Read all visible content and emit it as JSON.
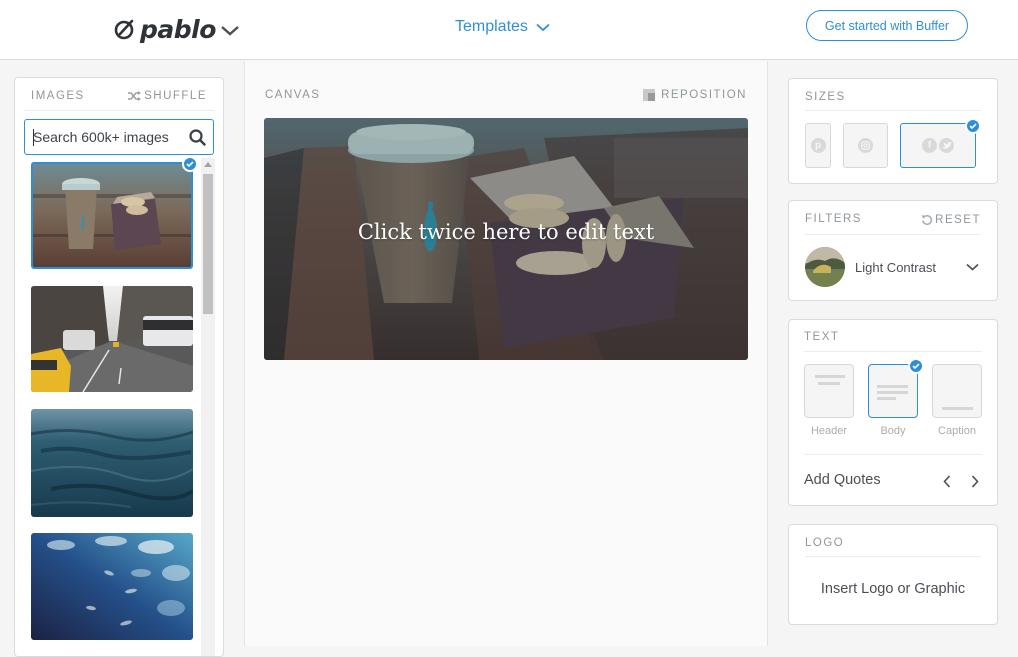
{
  "header": {
    "logo_text": "pablo",
    "templates_label": "Templates",
    "cta_label": "Get started with Buffer"
  },
  "images_panel": {
    "title": "IMAGES",
    "shuffle_label": "SHUFFLE",
    "search": {
      "value": "",
      "placeholder": "Search 600k+ images"
    },
    "thumbnails": [
      {
        "subject": "coffee cup and macarons",
        "selected": true
      },
      {
        "subject": "city street with taxis",
        "selected": false
      },
      {
        "subject": "dark sea water",
        "selected": false
      },
      {
        "subject": "fish in blue water",
        "selected": false
      }
    ]
  },
  "canvas_panel": {
    "title": "CANVAS",
    "reposition_label": "REPOSITION",
    "overlay_text": "Click twice here to edit text"
  },
  "sizes_panel": {
    "title": "SIZES",
    "options": [
      {
        "name": "Pinterest",
        "icons": [
          "pinterest-icon"
        ],
        "selected": false
      },
      {
        "name": "Instagram",
        "icons": [
          "instagram-icon"
        ],
        "selected": false
      },
      {
        "name": "Facebook / Twitter",
        "icons": [
          "facebook-icon",
          "twitter-icon"
        ],
        "selected": true
      }
    ]
  },
  "filters_panel": {
    "title": "FILTERS",
    "reset_label": "RESET",
    "selected_filter": "Light Contrast"
  },
  "text_panel": {
    "title": "TEXT",
    "styles": [
      {
        "label": "Header",
        "selected": false
      },
      {
        "label": "Body",
        "selected": true
      },
      {
        "label": "Caption",
        "selected": false
      }
    ],
    "add_quotes_label": "Add Quotes"
  },
  "logo_panel": {
    "title": "LOGO",
    "insert_label": "Insert Logo or Graphic"
  },
  "colors": {
    "accent": "#2c8fd8",
    "text": "#4a4f55",
    "muted": "#8f969c",
    "background": "#f5f5f5"
  }
}
